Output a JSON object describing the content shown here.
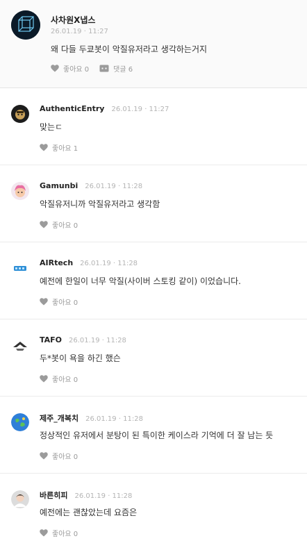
{
  "post": {
    "author": "사차원X냅스",
    "time": "26.01.19 · 11:27",
    "text": "왜 다들 두쿄봇이 악질유저라고 생각하는거지",
    "likes_label": "좋아요 0",
    "comments_label": "댓글 6"
  },
  "comments": [
    {
      "author": "AuthenticEntry",
      "time": "26.01.19 · 11:27",
      "text": "맞는ㄷ",
      "likes_label": "좋아요 1"
    },
    {
      "author": "Gamunbi",
      "time": "26.01.19 · 11:28",
      "text": "악질유저니까 악질유저라고 생각함",
      "likes_label": "좋아요 0"
    },
    {
      "author": "AIRtech",
      "time": "26.01.19 · 11:28",
      "text": "예전에 한일이 너무 악질(사이버 스토킹 같이) 이었습니다.",
      "likes_label": "좋아요 0"
    },
    {
      "author": "TAFO",
      "time": "26.01.19 · 11:28",
      "text": "두*봇이 욕을 하긴 했슨",
      "likes_label": "좋아요 0"
    },
    {
      "author": "제주_개복치",
      "time": "26.01.19 · 11:28",
      "text": "정상적인 유저에서 분탕이 된 특이한 케이스라 기억에 더 잘 남는 듯",
      "likes_label": "좋아요 0"
    },
    {
      "author": "바른히피",
      "time": "26.01.19 · 11:28",
      "text": "예전에는 괜찮았는데 요즘은",
      "likes_label": "좋아요 0"
    }
  ],
  "icons": {
    "like": "heart-icon",
    "comment": "comment-icon"
  },
  "colors": {
    "meta": "#b4b4b4",
    "action": "#999999",
    "divider": "#ebebeb",
    "post_bg": "#fafafa"
  }
}
